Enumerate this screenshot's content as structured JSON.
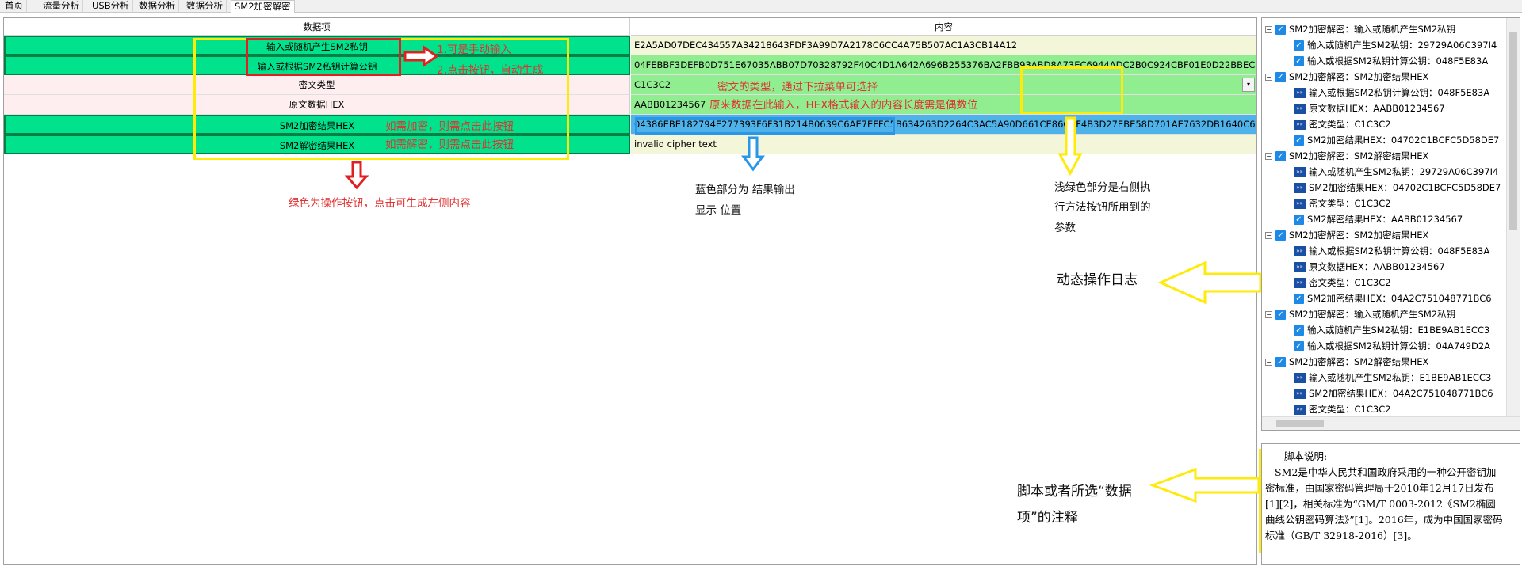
{
  "tabs": [
    "首页",
    "流量分析",
    "USB分析",
    "数据分析",
    "数据分析",
    "SM2加密解密"
  ],
  "grid": {
    "headers": [
      "数据项",
      "内容"
    ],
    "rows": [
      {
        "name": "输入或随机产生SM2私钥",
        "value": "E2A5AD07DEC434557A34218643FDF3A99D7A2178C6CC4A75B507AC1A3CB14A12"
      },
      {
        "name": "输入或根据SM2私钥计算公钥",
        "value": "04FEBBF3DEFB0D751E67035ABB07D70328792F40C4D1A642A696B255376BA2FBB93ABD8A73EC6944ADC2B0C924CBF01E0D22BBEC..."
      },
      {
        "name": "密文类型",
        "value": "C1C3C2"
      },
      {
        "name": "原文数据HEX",
        "value": "AABB01234567"
      },
      {
        "name": "SM2加密结果HEX",
        "value": "04386EBE182794E277393F6F31B214B0639C6AE7EFFC5B634263D2264C3AC5A90D661CE86CBF4B3D27EBE58D701AE7632DB1640C6A5..."
      },
      {
        "name": "SM2解密结果HEX",
        "value": "invalid cipher text"
      }
    ],
    "combo_arrow": "▾"
  },
  "annotations": {
    "manual_input": "1.可是手动输入",
    "auto_generate": "2.点击按钮，自动生成",
    "cipher_type_note": "密文的类型，通过下拉菜单可选择",
    "plain_note": "原来数据在此输入，HEX格式输入的内容长度需是偶数位",
    "encrypt_note": "如需加密，则需点击此按钮",
    "decrypt_note": "如需解密，则需点击此按钮",
    "green_note": "绿色为操作按钮，点击可生成左侧内容",
    "blue_note_1": "蓝色部分为 结果输出",
    "blue_note_2": "显示 位置",
    "lightgreen_note_1": "浅绿色部分是右侧执",
    "lightgreen_note_2": "行方法按钮所用到的",
    "lightgreen_note_3": "参数",
    "log_note": "动态操作日志",
    "comment_note_1": "脚本或者所选“数据",
    "comment_note_2": "项”的注释"
  },
  "log": [
    {
      "level": 0,
      "kind": "group",
      "text": "SM2加密解密：输入或随机产生SM2私钥"
    },
    {
      "level": 1,
      "kind": "check",
      "text": "输入或随机产生SM2私钥：29729A06C397I4"
    },
    {
      "level": 1,
      "kind": "check",
      "text": "输入或根据SM2私钥计算公钥：048F5E83A"
    },
    {
      "level": 0,
      "kind": "group",
      "text": "SM2加密解密：SM2加密结果HEX"
    },
    {
      "level": 1,
      "kind": "act",
      "text": "输入或根据SM2私钥计算公钥：048F5E83A"
    },
    {
      "level": 1,
      "kind": "act",
      "text": "原文数据HEX：AABB01234567"
    },
    {
      "level": 1,
      "kind": "act",
      "text": "密文类型：C1C3C2"
    },
    {
      "level": 1,
      "kind": "check",
      "text": "SM2加密结果HEX：04702C1BCFC5D58DE7"
    },
    {
      "level": 0,
      "kind": "group",
      "text": "SM2加密解密：SM2解密结果HEX"
    },
    {
      "level": 1,
      "kind": "act",
      "text": "输入或随机产生SM2私钥：29729A06C397I4"
    },
    {
      "level": 1,
      "kind": "act",
      "text": "SM2加密结果HEX：04702C1BCFC5D58DE7"
    },
    {
      "level": 1,
      "kind": "act",
      "text": "密文类型：C1C3C2"
    },
    {
      "level": 1,
      "kind": "check",
      "text": "SM2解密结果HEX：AABB01234567"
    },
    {
      "level": 0,
      "kind": "group",
      "text": "SM2加密解密：SM2加密结果HEX"
    },
    {
      "level": 1,
      "kind": "act",
      "text": "输入或根据SM2私钥计算公钥：048F5E83A"
    },
    {
      "level": 1,
      "kind": "act",
      "text": "原文数据HEX：AABB01234567"
    },
    {
      "level": 1,
      "kind": "act",
      "text": "密文类型：C1C3C2"
    },
    {
      "level": 1,
      "kind": "check",
      "text": "SM2加密结果HEX：04A2C751048771BC6"
    },
    {
      "level": 0,
      "kind": "group",
      "text": "SM2加密解密：输入或随机产生SM2私钥"
    },
    {
      "level": 1,
      "kind": "check",
      "text": "输入或随机产生SM2私钥：E1BE9AB1ECC3"
    },
    {
      "level": 1,
      "kind": "check",
      "text": "输入或根据SM2私钥计算公钥：04A749D2A"
    },
    {
      "level": 0,
      "kind": "group",
      "text": "SM2加密解密：SM2解密结果HEX"
    },
    {
      "level": 1,
      "kind": "act",
      "text": "输入或随机产生SM2私钥：E1BE9AB1ECC3"
    },
    {
      "level": 1,
      "kind": "act",
      "text": "SM2加密结果HEX：04A2C751048771BC6"
    },
    {
      "level": 1,
      "kind": "act",
      "text": "密文类型：C1C3C2"
    },
    {
      "level": 1,
      "kind": "check",
      "text": "SM2解密结果HEX：invalid cipher text"
    }
  ],
  "description": {
    "title": "脚本说明:",
    "body": "SM2是中华人民共和国政府采用的一种公开密钥加密标准，由国家密码管理局于2010年12月17日发布[1][2]，相关标准为“GM/T 0003-2012《SM2椭圆曲线公钥密码算法》”[1]。2016年，成为中国国家密码标准（GB/T 32918-2016）[3]。"
  },
  "colors": {
    "button_green": "#00e38c",
    "param_lightgreen": "#90ee90",
    "output_blue": "#4fb3ea",
    "annotation_yellow": "#ffeb0a",
    "annotation_red": "#e02020",
    "annotation_blue": "#2a96e8"
  }
}
